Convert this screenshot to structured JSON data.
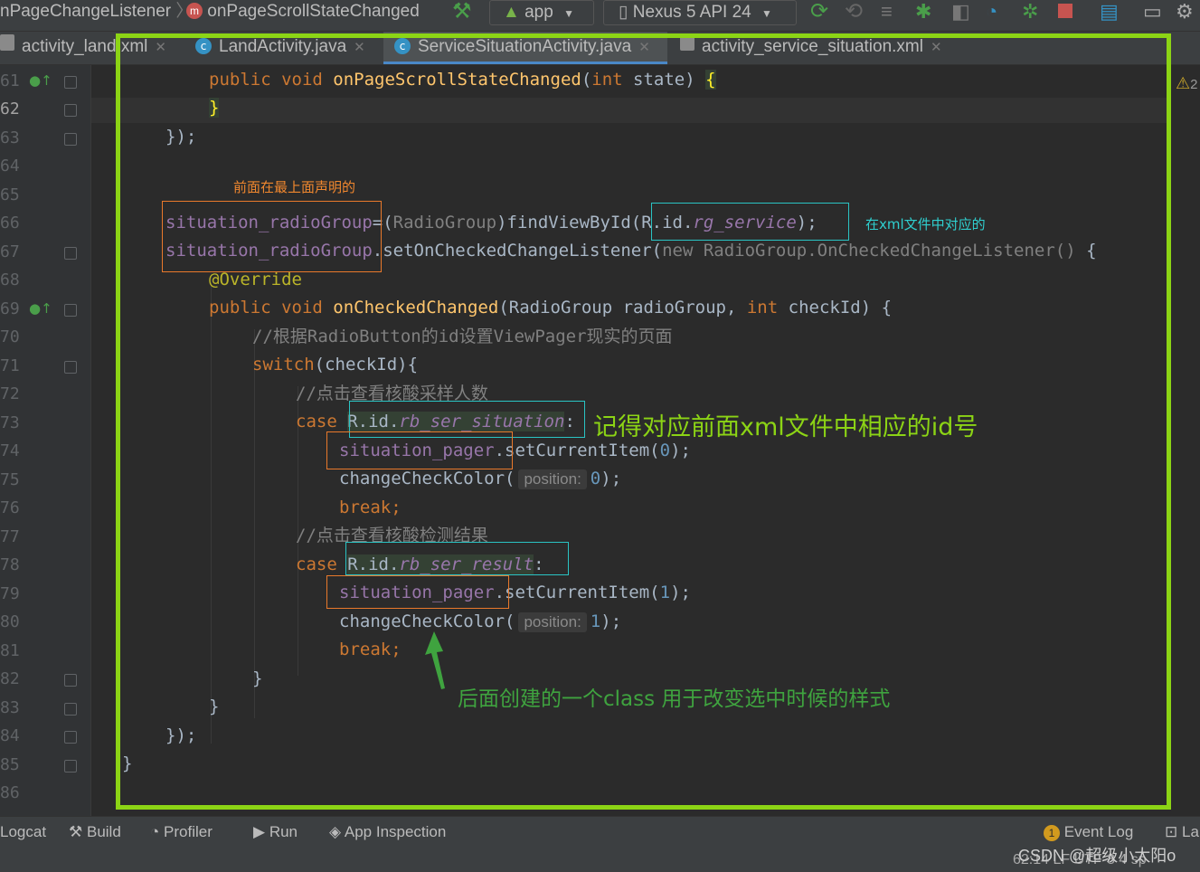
{
  "toolbar": {
    "crumb1": "nPageChangeListener",
    "crumb_sep": "〉",
    "crumb2_badge": "m",
    "crumb2": "onPageScrollStateChanged",
    "run_config": "app",
    "device": "Nexus 5 API 24"
  },
  "tabs": [
    {
      "label": "activity_land.xml"
    },
    {
      "label": "LandActivity.java"
    },
    {
      "label": "ServiceSituationActivity.java"
    },
    {
      "label": "activity_service_situation.xml"
    }
  ],
  "gutter": {
    "lines": [
      "61",
      "62",
      "63",
      "64",
      "65",
      "66",
      "67",
      "68",
      "69",
      "70",
      "71",
      "72",
      "73",
      "74",
      "75",
      "76",
      "77",
      "78",
      "79",
      "80",
      "81",
      "82",
      "83",
      "84",
      "85",
      "86"
    ]
  },
  "code": {
    "l61_a": "public void ",
    "l61_b": "onPageScrollStateChanged",
    "l61_c": "(",
    "l61_d": "int ",
    "l61_e": "state) ",
    "l61_f": "{",
    "l62": "}",
    "l63": "});",
    "l66_a": "situation_radioGroup",
    "l66_b": "=(",
    "l66_c": "RadioGroup",
    "l66_d": ")findViewById(R.id.",
    "l66_e": "rg_service",
    "l66_f": ");",
    "l67_a": "situation_radioGroup",
    "l67_b": ".setOnCheckedChangeListener(",
    "l67_c": "new RadioGroup.OnCheckedChangeListener()",
    "l67_d": " {",
    "l68": "@Override",
    "l69_a": "public void ",
    "l69_b": "onCheckedChanged",
    "l69_c": "(RadioGroup radioGroup, ",
    "l69_d": "int ",
    "l69_e": "checkId) {",
    "l70": "//根据RadioButton的id设置ViewPager现实的页面",
    "l71_a": "switch",
    "l71_b": "(checkId){",
    "l72": "//点击查看核酸采样人数",
    "l73_a": "case ",
    "l73_b": "R.id.",
    "l73_c": "rb_ser_situation",
    "l73_d": ":",
    "l74_a": "situation_pager",
    "l74_b": ".setCurrentItem(",
    "l74_c": "0",
    "l74_d": ");",
    "l75_a": "changeCheckColor(",
    "l75_hint": "position:",
    "l75_c": "0",
    "l75_d": ");",
    "l76": "break;",
    "l77": "//点击查看核酸检测结果",
    "l78_a": "case ",
    "l78_b": "R.id.",
    "l78_c": "rb_ser_result",
    "l78_d": ":",
    "l79_a": "situation_pager",
    "l79_b": ".setCurrentItem(",
    "l79_c": "1",
    "l79_d": ");",
    "l80_a": "changeCheckColor(",
    "l80_hint": "position:",
    "l80_c": "1",
    "l80_d": ");",
    "l81": "break;",
    "l82": "}",
    "l83": "}",
    "l84": "});",
    "l85": "}"
  },
  "annotations": {
    "declared_above": "前面在最上面声明的",
    "xml_counterpart": "在xml文件中对应的",
    "remember_id": "记得对应前面xml文件中相应的id号",
    "class_note": "后面创建的一个class 用于改变选中时候的样式"
  },
  "bottombar": {
    "logcat": "Logcat",
    "build": "Build",
    "profiler": "Profiler",
    "run": "Run",
    "app_inspection": "App Inspection",
    "event_log_count": "1",
    "event_log": "Event Log",
    "layout_partial": "La"
  },
  "statusbar": {
    "position": "62:14",
    "line_sep": "LF",
    "encoding": "UTF-8",
    "indent": "4 sp",
    "watermark": "CSDN @超级小太阳o"
  },
  "warnings": {
    "count": "2"
  },
  "colors": {
    "frame": "#8cd415",
    "orange_box": "#e9792b",
    "cyan_box": "#2ac4c4",
    "note_orange": "#f0872e",
    "note_cyan": "#2fd0d0",
    "note_green": "#8cd415",
    "note_darkgreen": "#3fa33f"
  }
}
